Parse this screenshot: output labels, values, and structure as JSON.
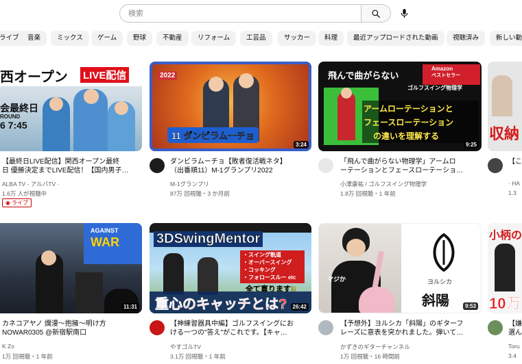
{
  "search": {
    "placeholder": "検索",
    "value": ""
  },
  "chips": [
    "ライブ",
    "音楽",
    "ミックス",
    "ゲーム",
    "野球",
    "不動産",
    "リフォーム",
    "工芸品",
    "サッカー",
    "料理",
    "最近アップロードされた動画",
    "視聴済み",
    "新しい動画の発見"
  ],
  "videos": [
    {
      "title_line1": "【最終日LIVE配信】関西オープン最終",
      "title_line2": "日 優勝決定までLIVE配信！【国内男子…",
      "channel": "ALBA TV - アルバTV ·",
      "stats": "1.6万 人が視聴中",
      "live_label": "ライブ",
      "duration": "",
      "thumb_text": {
        "a": "西オープン",
        "b": "LIVE配信",
        "c": "会最終日",
        "d": "ROUND",
        "e": "6 7:45"
      }
    },
    {
      "title_line1": "ダンビラムーチョ【敗者復活戦ネタ】",
      "title_line2": "（出番順11）M-1グランプリ2022",
      "channel": "M-1グランプリ",
      "stats": "87万 回視聴・3 か月前",
      "duration": "3:24",
      "thumb_text": {
        "a": "2022",
        "b": "11 ダンビラムーチョ"
      }
    },
    {
      "title_line1": "「飛んで曲がらない物理学」アームロ",
      "title_line2": "ーテーションとフェースローテーショ…",
      "channel": "小澤康祐 / ゴルフスイング物理学",
      "stats": "1.8万 回視聴・1 年前",
      "duration": "9:25",
      "thumb_text": {
        "a": "飛んで曲がらない",
        "b": "Amazon",
        "c": "ベストセラー",
        "d": "ゴルフスイング物理学",
        "e": "アームローテーションと",
        "f": "フェースローテーション",
        "g": "の違いを理解する"
      }
    },
    {
      "title_line1": "【こ",
      "title_line2": "",
      "channel": "· HA",
      "stats": "1.3",
      "duration": "",
      "thumb_text": {
        "a": "収納"
      }
    },
    {
      "title_line1": "カネコアヤノ 爛漫〜抱擁〜明け方",
      "title_line2": "NOWAR0305 @新宿駅南口",
      "channel": "K Zo",
      "stats": "1万 回視聴・1 年前",
      "duration": "11:31",
      "thumb_text": {
        "a": "AGAINST",
        "b": "WAR"
      }
    },
    {
      "title_line1": "【神練習器具中編】ゴルフスイングにお",
      "title_line2": "ける一つの\"答え\"がこれです。【キャ…",
      "channel": "やすゴルTV",
      "stats": "3.1万 回視聴・1 年前",
      "duration": "26:42",
      "thumb_text": {
        "a": "3DSwingMentor",
        "b": "・スイング軌道",
        "c": "・オーバースイング",
        "d": "・コッキング",
        "e": "・フォロースルー etc",
        "f": "全て直ります!!",
        "g": "重心のキャッチとは?"
      }
    },
    {
      "title_line1": "【予想外】ヨルシカ「斜陽」のギターフ",
      "title_line2": "レーズに意表を突かれました。弾いて…",
      "channel": "かずきのギターチャンネル",
      "stats": "1万 回視聴・16 時間前",
      "duration": "9:53",
      "thumb_text": {
        "a": "マジか",
        "b": "ヨルシカ",
        "c": "斜陽"
      }
    },
    {
      "title_line1": "【嫌",
      "title_line2": "選ん",
      "channel": "Toru",
      "stats": "3.4",
      "duration": "",
      "thumb_text": {
        "a": "小柄の",
        "b": "10万"
      }
    }
  ],
  "colors": {
    "accent": "#cc0000",
    "text": "#0f0f0f",
    "secondary": "#606060",
    "chip_bg": "#f2f2f2"
  }
}
